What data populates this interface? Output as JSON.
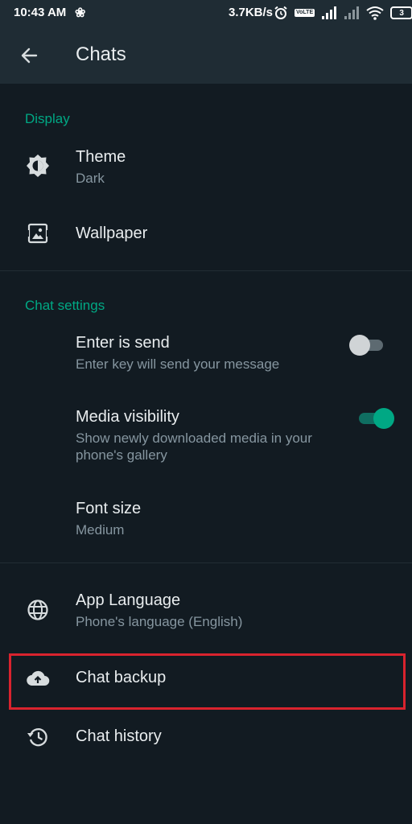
{
  "status_bar": {
    "time": "10:43 AM",
    "speed": "3.7KB/s",
    "battery": "3",
    "volte": "VoLTE",
    "icons": [
      "app-notification-icon",
      "alarm-icon",
      "volte-icon",
      "signal-icon",
      "signal-no-service-icon",
      "wifi-icon",
      "battery-icon"
    ]
  },
  "header": {
    "title": "Chats",
    "back_icon": "arrow-back-icon"
  },
  "sections": {
    "display": "Display",
    "chat_settings": "Chat settings"
  },
  "items": {
    "theme": {
      "title": "Theme",
      "subtitle": "Dark",
      "icon": "brightness-icon"
    },
    "wallpaper": {
      "title": "Wallpaper",
      "icon": "wallpaper-icon"
    },
    "enter_is_send": {
      "title": "Enter is send",
      "subtitle": "Enter key will send your message",
      "enabled": false
    },
    "media_visibility": {
      "title": "Media visibility",
      "subtitle": "Show newly downloaded media in your phone's gallery",
      "enabled": true
    },
    "font_size": {
      "title": "Font size",
      "subtitle": "Medium"
    },
    "app_language": {
      "title": "App Language",
      "subtitle": "Phone's language (English)",
      "icon": "globe-icon"
    },
    "chat_backup": {
      "title": "Chat backup",
      "icon": "cloud-upload-icon",
      "highlighted": true
    },
    "chat_history": {
      "title": "Chat history",
      "icon": "history-icon"
    }
  },
  "colors": {
    "background": "#121b22",
    "app_bar": "#1f2c34",
    "accent": "#00a884",
    "primary_text": "#e9edef",
    "secondary_text": "#8696a0",
    "highlight": "#d9232e"
  }
}
